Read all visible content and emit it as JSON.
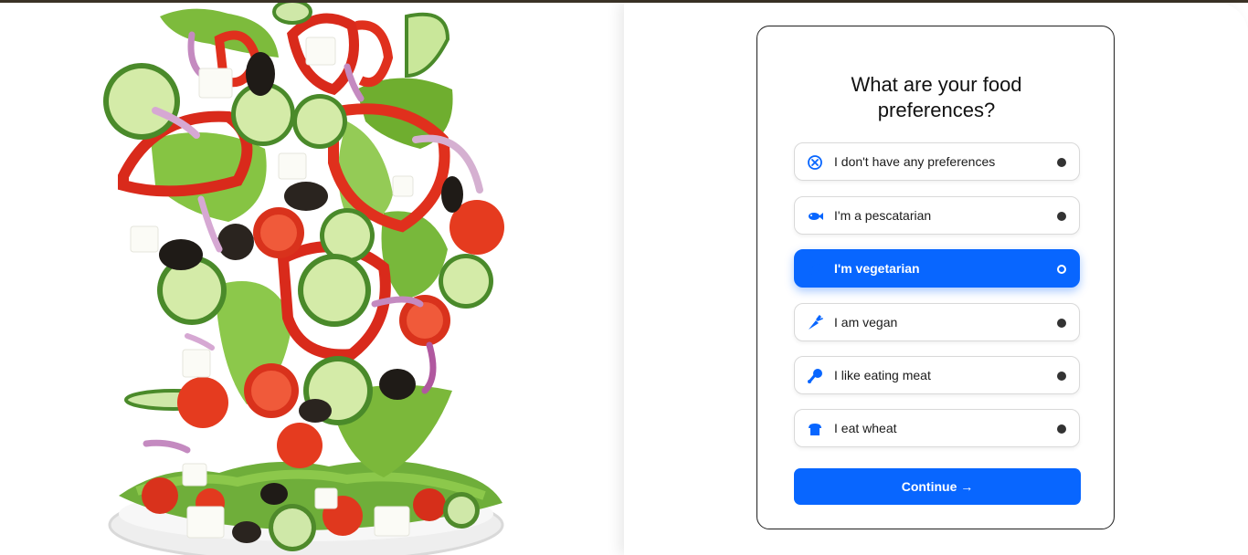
{
  "colors": {
    "accent": "#0866ff",
    "card_border": "#1f1f1f",
    "radio_fill": "#333333"
  },
  "hero_image": {
    "icon": "salad-illustration"
  },
  "survey": {
    "title": "What are your food preferences?",
    "options": [
      {
        "label": "I don't have any preferences",
        "icon": "no-preference-icon",
        "selected": false
      },
      {
        "label": "I'm a pescatarian",
        "icon": "fish-icon",
        "selected": false
      },
      {
        "label": "I'm vegetarian",
        "icon": "leaf-icon",
        "selected": true
      },
      {
        "label": "I am vegan",
        "icon": "carrot-icon",
        "selected": false
      },
      {
        "label": "I like eating meat",
        "icon": "drumstick-icon",
        "selected": false
      },
      {
        "label": "I eat wheat",
        "icon": "bread-icon",
        "selected": false
      }
    ],
    "continue_label": "Continue →"
  }
}
